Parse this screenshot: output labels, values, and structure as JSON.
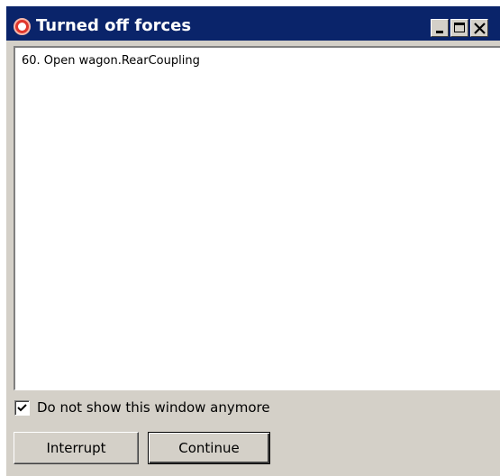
{
  "window": {
    "title": "Turned off forces",
    "title_bar_color": "#0a246a",
    "face_color": "#d4d0c8",
    "icon": "red-ring-icon",
    "controls": {
      "minimize": "minimize-icon",
      "maximize": "maximize-icon",
      "close": "close-icon"
    }
  },
  "content": {
    "lines": [
      "60. Open wagon.RearCoupling"
    ]
  },
  "options": {
    "hide_label": "Do not show this window anymore",
    "hide_checked": true
  },
  "buttons": {
    "interrupt_label": "Interrupt",
    "continue_label": "Continue"
  }
}
